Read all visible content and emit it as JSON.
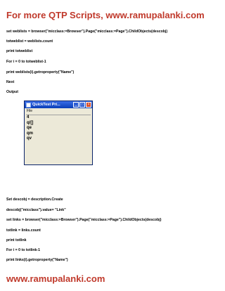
{
  "header": {
    "title": "For more QTP Scripts, www.ramupalanki.com"
  },
  "lines": [
    "set  weblists = browser(\"micclass:=Browser\").Page(\"micclass:=Page\").ChildObjects(descobj)",
    "totweblist = weblists.count",
    "print totweblist",
    "For i = 0 to totweblist-1",
    "print weblists(i).getroproperty(\"Name\")",
    "Next",
    "Output"
  ],
  "output_window": {
    "title": "QuickTest Pri...",
    "menu": "File",
    "buttons": [
      "_",
      "□",
      "×"
    ],
    "output_lines": [
      "4",
      "q/[]",
      "qe",
      "qm",
      "qv"
    ]
  },
  "lines2": [
    "Set descobj = description.Create",
    "descobj(\"micclass\").value= \"Link\"",
    "set  links = browser(\"micclass:=Browser\").Page(\"micclass:=Page\").ChildObjects(descobj)",
    "totlink = links.count",
    "print totlink",
    "For i = 0 to totlink-1",
    "print links(i).getroproperty(\"Name\")"
  ],
  "footer": {
    "text": "www.ramupalanki.com"
  },
  "colors": {
    "accent": "#c0392b"
  }
}
